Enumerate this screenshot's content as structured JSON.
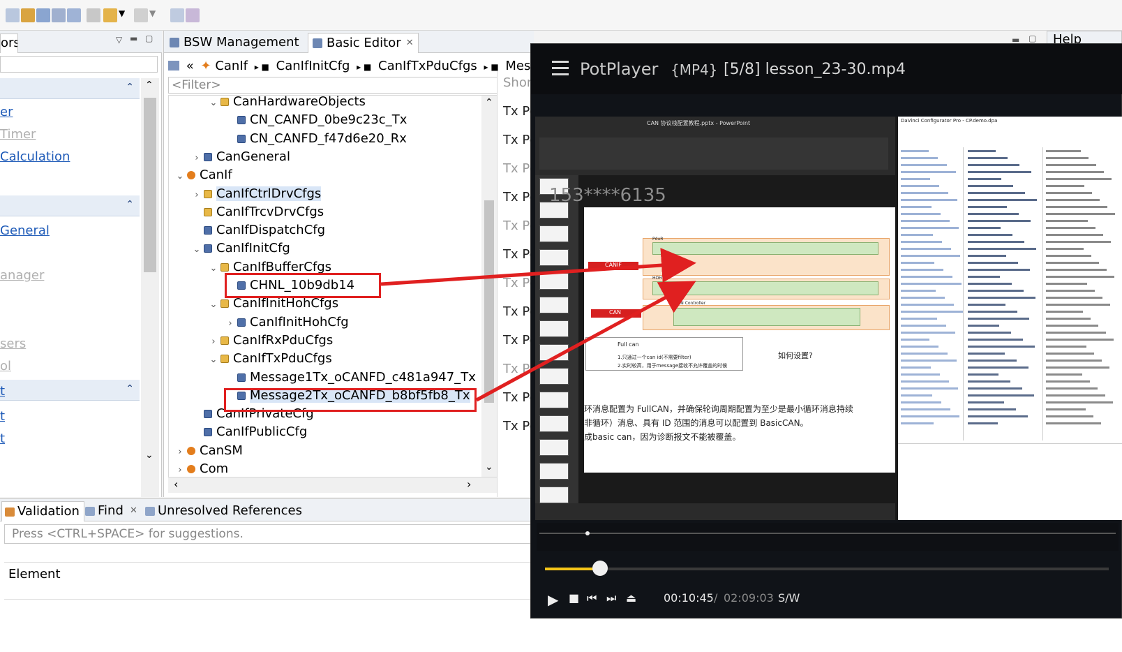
{
  "left_panel": {
    "tab_label": "ors",
    "links": [
      {
        "label": "er",
        "dim": false
      },
      {
        "label": "Timer",
        "dim": true
      },
      {
        "label": "Calculation",
        "dim": false
      },
      {
        "label": "General",
        "dim": false
      },
      {
        "label": "anager",
        "dim": true
      },
      {
        "label": "sers",
        "dim": true
      },
      {
        "label": "ol",
        "dim": true
      },
      {
        "label": "t",
        "dim": false
      },
      {
        "label": "t",
        "dim": false
      },
      {
        "label": "t",
        "dim": false
      }
    ]
  },
  "editor": {
    "tabs": [
      "BSW Management",
      "Basic Editor"
    ],
    "breadcrumb": [
      "CanIf",
      "CanIfInitCfg",
      "CanIfTxPduCfgs",
      "Messa"
    ],
    "filter_placeholder": "<Filter>",
    "tree": [
      {
        "label": "CanHardwareObjects",
        "indent": 2,
        "icon": "folder",
        "twisty": "v"
      },
      {
        "label": "CN_CANFD_0be9c23c_Tx",
        "indent": 3,
        "icon": "blue",
        "twisty": ""
      },
      {
        "label": "CN_CANFD_f47d6e20_Rx",
        "indent": 3,
        "icon": "blue",
        "twisty": ""
      },
      {
        "label": "CanGeneral",
        "indent": 1,
        "icon": "blue",
        "twisty": ">"
      },
      {
        "label": "CanIf",
        "indent": 0,
        "icon": "orange",
        "twisty": "v"
      },
      {
        "label": "CanIfCtrlDrvCfgs",
        "indent": 1,
        "icon": "folder",
        "twisty": ">",
        "selected": true
      },
      {
        "label": "CanIfTrcvDrvCfgs",
        "indent": 1,
        "icon": "folder",
        "twisty": ""
      },
      {
        "label": "CanIfDispatchCfg",
        "indent": 1,
        "icon": "blue",
        "twisty": ""
      },
      {
        "label": "CanIfInitCfg",
        "indent": 1,
        "icon": "blue",
        "twisty": "v"
      },
      {
        "label": "CanIfBufferCfgs",
        "indent": 2,
        "icon": "folder",
        "twisty": "v"
      },
      {
        "label": "CHNL_10b9db14",
        "indent": 3,
        "icon": "blue",
        "twisty": ""
      },
      {
        "label": "CanIfInitHohCfgs",
        "indent": 2,
        "icon": "folder",
        "twisty": "v"
      },
      {
        "label": "CanIfInitHohCfg",
        "indent": 3,
        "icon": "blue",
        "twisty": ">"
      },
      {
        "label": "CanIfRxPduCfgs",
        "indent": 2,
        "icon": "folder",
        "twisty": ">"
      },
      {
        "label": "CanIfTxPduCfgs",
        "indent": 2,
        "icon": "folder",
        "twisty": "v"
      },
      {
        "label": "Message1Tx_oCANFD_c481a947_Tx",
        "indent": 3,
        "icon": "blue",
        "twisty": ""
      },
      {
        "label": "Message2Tx_oCANFD_b8bf5fb8_Tx",
        "indent": 3,
        "icon": "blue",
        "twisty": "",
        "selected": true
      },
      {
        "label": "CanIfPrivateCfg",
        "indent": 1,
        "icon": "blue",
        "twisty": ""
      },
      {
        "label": "CanIfPublicCfg",
        "indent": 1,
        "icon": "blue",
        "twisty": ""
      },
      {
        "label": "CanSM",
        "indent": 0,
        "icon": "orange",
        "twisty": ">"
      },
      {
        "label": "Com",
        "indent": 0,
        "icon": "orange",
        "twisty": ">"
      }
    ]
  },
  "right_column": {
    "labels": [
      "Shor",
      "Tx Po",
      "Tx Po",
      "Tx Po",
      "Tx Po",
      "Tx Po",
      "Tx Po",
      "Tx Po",
      "Tx Po",
      "Tx Po",
      "Tx Po",
      "Tx Po",
      "Tx Po"
    ],
    "help_tab": "Help"
  },
  "bottom": {
    "tabs": [
      "Validation",
      "Find",
      "Unresolved References"
    ],
    "input_placeholder": "Press <CTRL+SPACE> for suggestions.",
    "column_header": "Element"
  },
  "player": {
    "brand": "PotPlayer",
    "format": "{MP4}",
    "file": "[5/8] lesson_23-30.mp4",
    "time_current": "00:10:45",
    "time_separator": "/",
    "time_total": "02:09:03",
    "mode": "S/W",
    "progress_fraction": 0.1
  },
  "video_content": {
    "ppt_title": "CAN 协议栈配置教程.pptx - PowerPoint",
    "watermark": "153****6135",
    "slide_labels": {
      "canif": "CANIF",
      "can": "CAN",
      "pdur": "PduR",
      "hoh": "HOH",
      "controller": "CAN Controller",
      "full_can": "Full can",
      "note1": "1.只通过一个can id(不需要filter)",
      "note2": "2.实时较高，用于message接收不允许覆盖的时候",
      "question": "如何设置?",
      "line1": "环消息配置为 FullCAN，并确保轮询周期配置为至少是最小循环消息持续",
      "line2": "非循环）消息、具有 ID 范围的消息可以配置到 BasicCAN。",
      "line3": "成basic can，因为诊断报文不能被覆盖。"
    },
    "cfg_title": "DaVinci Configurator Pro - CP.demo.dpa"
  },
  "colors": {
    "annotation_red": "#e02020",
    "link_blue": "#1f5bb8",
    "progress_yellow": "#f5c518"
  }
}
